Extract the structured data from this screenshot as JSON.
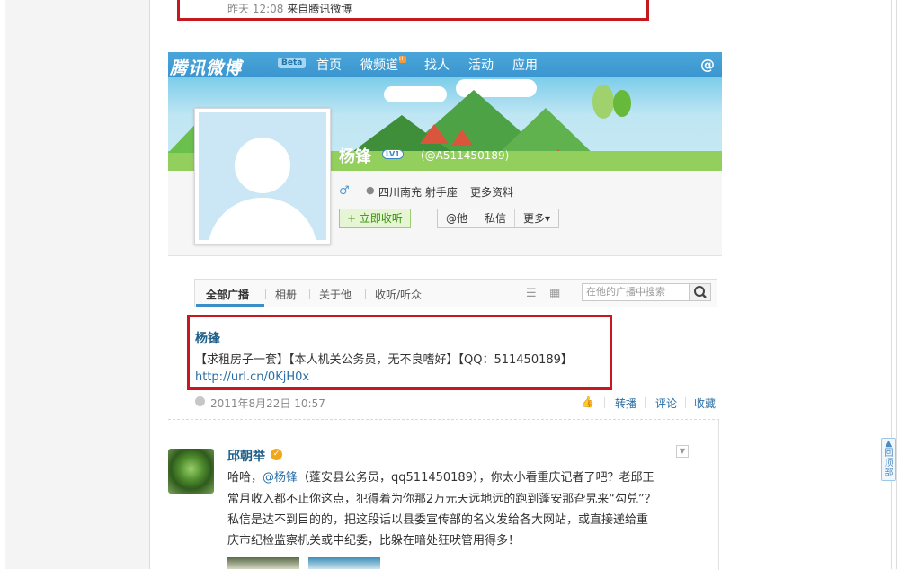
{
  "top_post": {
    "time": "昨天 12:08",
    "source": "来自腾讯微博"
  },
  "header": {
    "logo": "腾讯微博",
    "beta": "Beta",
    "nav": [
      "首页",
      "微频道",
      "找人",
      "活动",
      "应用"
    ],
    "hot_badge": "H",
    "at_icon": "@"
  },
  "profile": {
    "name": "杨锋",
    "level": "LV1",
    "handle": "(@A511450189)",
    "gender_icon": "♂",
    "location": "四川南充 射手座",
    "more_info": "更多资料",
    "follow_button": "+ 立即收听",
    "actions": [
      "@他",
      "私信",
      "更多▾"
    ]
  },
  "tabs": {
    "items": [
      "全部广播",
      "相册",
      "关于他",
      "收听/听众"
    ],
    "active": "全部广播",
    "search_placeholder": "在他的广播中搜索"
  },
  "post": {
    "author": "杨锋",
    "text": "【求租房子一套】【本人机关公务员，无不良嗜好】【QQ：511450189】",
    "link": "http://url.cn/0KjH0x",
    "time": "2011年8月22日 10:57",
    "actions": [
      "转播",
      "评论",
      "收藏"
    ]
  },
  "comment": {
    "author": "邱朝举",
    "lines": [
      {
        "pre": "哈哈，",
        "mention": "@杨锋",
        "post": "（蓬安县公务员，qq511450189），你太小看重庆记者了吧？老邱正"
      },
      {
        "pre": "常月收入都不止你这点，犯得着为你那2万元天远地远的跑到蓬安那旮旯来“勾兑”？",
        "mention": "",
        "post": ""
      },
      {
        "pre": "私信是达不到目的的，把这段话以县委宣传部的名义发给各大网站，或直接递给重",
        "mention": "",
        "post": ""
      },
      {
        "pre": "庆市纪检监察机关或中纪委，比躲在暗处狂吠管用得多！",
        "mention": "",
        "post": ""
      }
    ]
  },
  "back_to_top": "回顶部",
  "colors": {
    "nav_bg": "#3b95cf",
    "link": "#2b6ea5",
    "highlight_box": "#c6181f",
    "follow_green": "#3b8f10"
  }
}
